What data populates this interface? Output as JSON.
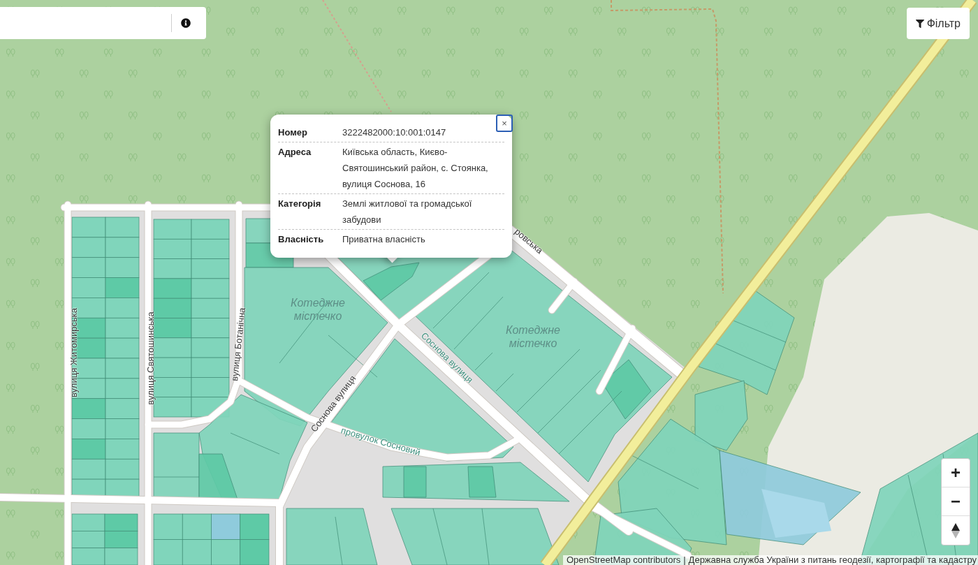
{
  "filter_button": {
    "label": "Фільтр"
  },
  "popup": {
    "close_button": {
      "label": "×",
      "focused": true
    },
    "rows": [
      {
        "label": "Номер",
        "value": "3222482000:10:001:0147"
      },
      {
        "label": "Адреса",
        "value": "Київська область, Києво-Святошинський район, с. Стоянка, вулиця Соснова, 16"
      },
      {
        "label": "Категорія",
        "value": "Землі житлової та громадської забудови"
      },
      {
        "label": "Власність",
        "value": "Приватна власність"
      }
    ]
  },
  "map_labels": [
    {
      "kind": "street",
      "text": "вулиця Житомирська"
    },
    {
      "kind": "street",
      "text": "вулиця Святошинська"
    },
    {
      "kind": "street",
      "text": "вулиця Ботанічна"
    },
    {
      "kind": "street",
      "text": "Соснова вулиця"
    },
    {
      "kind": "street",
      "text": "Соснова вулиця"
    },
    {
      "kind": "street",
      "text": "провулок Сосновий"
    },
    {
      "kind": "place",
      "text": "Котеджне містечко"
    },
    {
      "kind": "place",
      "text": "Котеджне містечко"
    },
    {
      "kind": "street",
      "text": "ровська"
    }
  ],
  "zoom_controls": {
    "zoom_in": "+",
    "zoom_out": "−"
  },
  "attribution": {
    "link": "OpenStreetMap contributors",
    "separator": "|",
    "text": "Державна служба України з питань геодезії, картографії та кадастру"
  }
}
